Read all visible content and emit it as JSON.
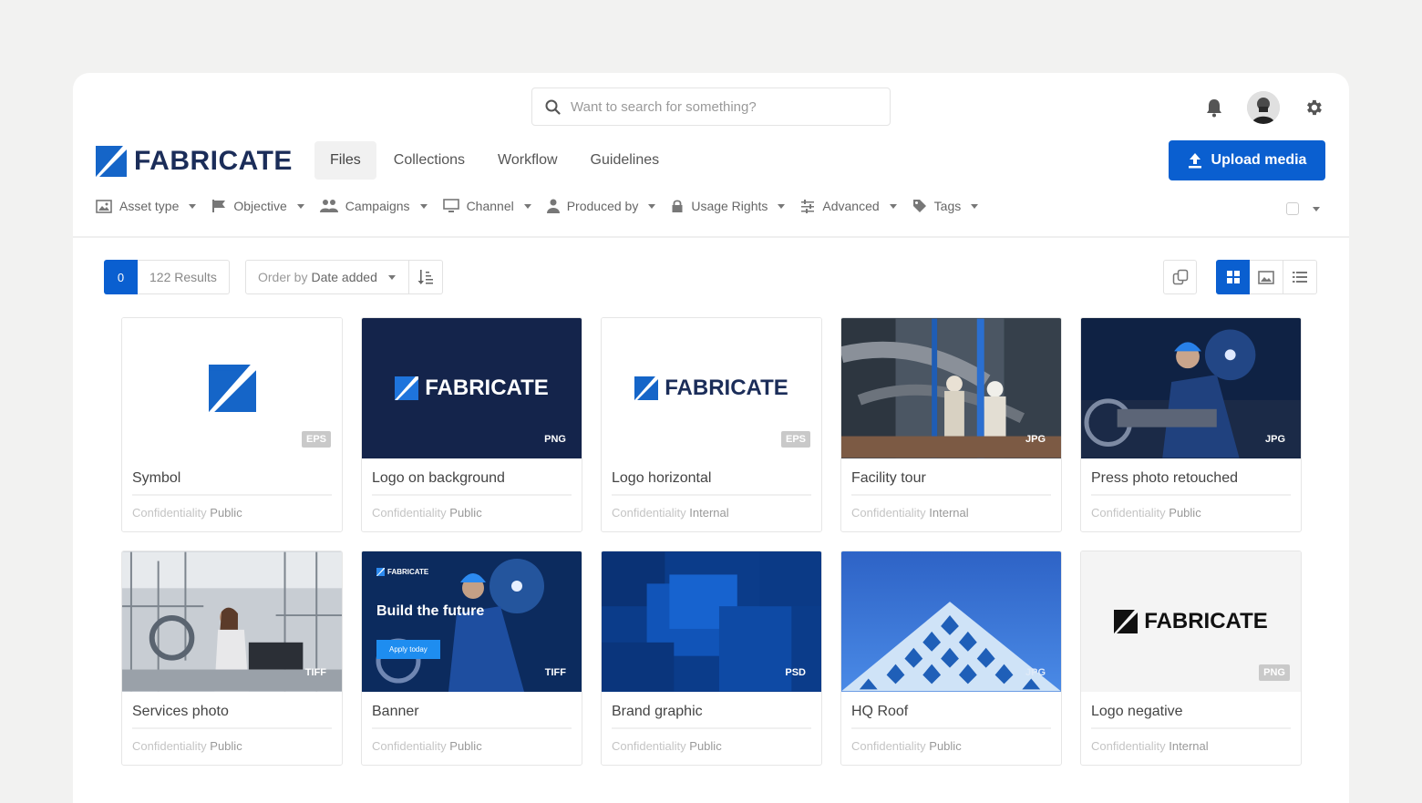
{
  "search": {
    "placeholder": "Want to search for something?"
  },
  "brand": {
    "name": "FABRICATE"
  },
  "nav": {
    "tabs": [
      {
        "label": "Files",
        "active": true
      },
      {
        "label": "Collections"
      },
      {
        "label": "Workflow"
      },
      {
        "label": "Guidelines"
      }
    ]
  },
  "upload": {
    "label": "Upload media"
  },
  "filters": [
    {
      "label": "Asset type",
      "icon": "image-icon"
    },
    {
      "label": "Objective",
      "icon": "flag-icon"
    },
    {
      "label": "Campaigns",
      "icon": "users-icon"
    },
    {
      "label": "Channel",
      "icon": "monitor-icon"
    },
    {
      "label": "Produced by",
      "icon": "user-icon"
    },
    {
      "label": "Usage Rights",
      "icon": "lock-icon"
    },
    {
      "label": "Advanced",
      "icon": "sliders-icon"
    },
    {
      "label": "Tags",
      "icon": "tag-icon"
    }
  ],
  "results": {
    "selected": "0",
    "label": "122 Results"
  },
  "order": {
    "prefix": "Order by",
    "value": "Date added"
  },
  "meta_label": "Confidentiality",
  "assets": [
    {
      "title": "Symbol",
      "ext": "EPS",
      "confidentiality": "Public"
    },
    {
      "title": "Logo on background",
      "ext": "PNG",
      "confidentiality": "Public"
    },
    {
      "title": "Logo horizontal",
      "ext": "EPS",
      "confidentiality": "Internal"
    },
    {
      "title": "Facility tour",
      "ext": "JPG",
      "confidentiality": "Internal"
    },
    {
      "title": "Press photo retouched",
      "ext": "JPG",
      "confidentiality": "Public"
    },
    {
      "title": "Services photo",
      "ext": "TIFF",
      "confidentiality": "Public"
    },
    {
      "title": "Banner",
      "ext": "TIFF",
      "confidentiality": "Public",
      "banner_brand": "FABRICATE",
      "banner_headline": "Build the future",
      "banner_cta": "Apply today"
    },
    {
      "title": "Brand graphic",
      "ext": "PSD",
      "confidentiality": "Public"
    },
    {
      "title": "HQ Roof",
      "ext": "JPG",
      "confidentiality": "Public"
    },
    {
      "title": "Logo negative",
      "ext": "PNG",
      "confidentiality": "Internal"
    }
  ],
  "colors": {
    "accent": "#0a5fd0",
    "brand_navy": "#1b2d59",
    "brand_blue": "#1565c8"
  }
}
